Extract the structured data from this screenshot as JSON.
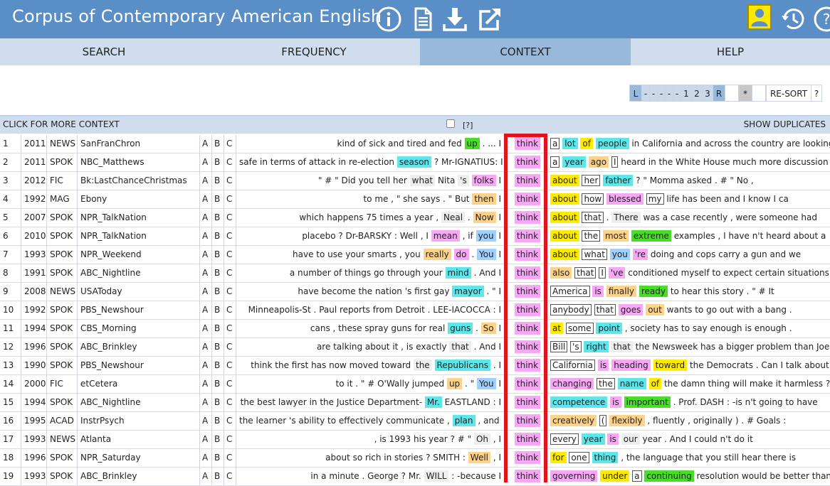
{
  "app": {
    "title": "Corpus of Contemporary American English",
    "icons": [
      "info-icon",
      "document-icon",
      "download-icon",
      "external-link-icon",
      "user-icon",
      "history-icon",
      "help-icon"
    ],
    "header_color": "#5a8ec6"
  },
  "tabs": [
    {
      "label": "SEARCH",
      "active": false
    },
    {
      "label": "FREQUENCY",
      "active": false
    },
    {
      "label": "CONTEXT",
      "active": true
    },
    {
      "label": "HELP",
      "active": false
    }
  ],
  "pager": {
    "items": [
      "L",
      "-",
      "-",
      "-",
      "-",
      "-",
      "1",
      "2",
      "3",
      "R",
      "",
      "*",
      "",
      "RE-SORT",
      "?"
    ]
  },
  "controls": {
    "more_context": "CLICK FOR MORE CONTEXT",
    "help_link": "[?]",
    "show_duplicates": "SHOW DUPLICATES"
  },
  "keyword": "think",
  "rows": [
    {
      "n": "1",
      "year": "2011",
      "genre": "NEWS",
      "source": "SanFranChron",
      "left": [
        [
          "kind of sick and tired and fed ",
          ""
        ],
        [
          "up",
          "green"
        ],
        [
          " . ... I",
          ""
        ]
      ],
      "right": [
        [
          "a",
          "bx"
        ],
        [
          " ",
          ""
        ],
        [
          "lot",
          "cyan"
        ],
        [
          " ",
          ""
        ],
        [
          "of",
          "yellow"
        ],
        [
          " ",
          ""
        ],
        [
          "people",
          "cyan"
        ],
        [
          " in California and across the country are looking",
          ""
        ]
      ]
    },
    {
      "n": "2",
      "year": "2011",
      "genre": "SPOK",
      "source": "NBC_Matthews",
      "left": [
        [
          "safe in terms of attack in re-election ",
          ""
        ],
        [
          "season",
          "cyan"
        ],
        [
          " ? Mr-IGNATIUS: I",
          ""
        ]
      ],
      "right": [
        [
          "a",
          "bx"
        ],
        [
          " ",
          ""
        ],
        [
          "year",
          "cyan"
        ],
        [
          " ",
          ""
        ],
        [
          "ago",
          "orange"
        ],
        [
          " ",
          ""
        ],
        [
          "I",
          "bx"
        ],
        [
          " heard in the White House much more discussion",
          ""
        ]
      ]
    },
    {
      "n": "3",
      "year": "2012",
      "genre": "FIC",
      "source": "Bk:LastChanceChristmas",
      "left": [
        [
          "\" # \" Did you tell her ",
          ""
        ],
        [
          "what",
          "grey"
        ],
        [
          " Nita ",
          ""
        ],
        [
          "'s",
          "grey"
        ],
        [
          " ",
          ""
        ],
        [
          "folks",
          "pink"
        ],
        [
          " I",
          ""
        ]
      ],
      "right": [
        [
          "about",
          "yellow"
        ],
        [
          " ",
          ""
        ],
        [
          "her",
          "bx"
        ],
        [
          " ",
          ""
        ],
        [
          "father",
          "cyan"
        ],
        [
          " ? \" Momma asked . # \" No ,",
          ""
        ]
      ]
    },
    {
      "n": "4",
      "year": "1992",
      "genre": "MAG",
      "source": "Ebony",
      "left": [
        [
          "to me , \" she says . \" But ",
          ""
        ],
        [
          "then",
          "orange"
        ],
        [
          " I",
          ""
        ]
      ],
      "right": [
        [
          "about",
          "yellow"
        ],
        [
          " ",
          ""
        ],
        [
          "how",
          "bx"
        ],
        [
          " ",
          ""
        ],
        [
          "blessed",
          "pink"
        ],
        [
          " ",
          ""
        ],
        [
          "my",
          "bx"
        ],
        [
          " life has been and I know I ca",
          ""
        ]
      ]
    },
    {
      "n": "5",
      "year": "2007",
      "genre": "SPOK",
      "source": "NPR_TalkNation",
      "left": [
        [
          "which happens 75 times a year , ",
          ""
        ],
        [
          "Neal",
          "grey"
        ],
        [
          " . ",
          ""
        ],
        [
          "Now",
          "orange"
        ],
        [
          " I",
          ""
        ]
      ],
      "right": [
        [
          "about",
          "yellow"
        ],
        [
          " ",
          ""
        ],
        [
          "that",
          "bx"
        ],
        [
          " . ",
          ""
        ],
        [
          "There",
          "grey"
        ],
        [
          " was a case recently , were someone had",
          ""
        ]
      ]
    },
    {
      "n": "6",
      "year": "2010",
      "genre": "SPOK",
      "source": "NPR_TalkNation",
      "left": [
        [
          "placebo ? Dr-BARSKY : Well , I ",
          ""
        ],
        [
          "mean",
          "pink"
        ],
        [
          " , if ",
          ""
        ],
        [
          "you",
          "blue"
        ],
        [
          " I",
          ""
        ]
      ],
      "right": [
        [
          "about",
          "yellow"
        ],
        [
          " ",
          ""
        ],
        [
          "the",
          "bx"
        ],
        [
          " ",
          ""
        ],
        [
          "most",
          "orange"
        ],
        [
          " ",
          ""
        ],
        [
          "extreme",
          "green"
        ],
        [
          " examples , I have n't heard about a",
          ""
        ]
      ]
    },
    {
      "n": "7",
      "year": "1993",
      "genre": "SPOK",
      "source": "NPR_Weekend",
      "left": [
        [
          "have to use your smarts , you ",
          ""
        ],
        [
          "really",
          "orange"
        ],
        [
          " ",
          ""
        ],
        [
          "do",
          "pink"
        ],
        [
          " . ",
          ""
        ],
        [
          "You",
          "blue"
        ],
        [
          " I",
          ""
        ]
      ],
      "right": [
        [
          "about",
          "yellow"
        ],
        [
          " ",
          ""
        ],
        [
          "what",
          "bx"
        ],
        [
          " ",
          ""
        ],
        [
          "you",
          "blue"
        ],
        [
          " ",
          ""
        ],
        [
          "'re",
          "pink"
        ],
        [
          " doing and cops carry a gun and we",
          ""
        ]
      ]
    },
    {
      "n": "8",
      "year": "1991",
      "genre": "SPOK",
      "source": "ABC_Nightline",
      "left": [
        [
          "a number of things go through your ",
          ""
        ],
        [
          "mind",
          "cyan"
        ],
        [
          " . And I",
          ""
        ]
      ],
      "right": [
        [
          "also",
          "orange"
        ],
        [
          " ",
          ""
        ],
        [
          "that",
          "bx"
        ],
        [
          " ",
          ""
        ],
        [
          "I",
          "bx"
        ],
        [
          " ",
          ""
        ],
        [
          "'ve",
          "pink"
        ],
        [
          " conditioned myself to expect certain situations",
          ""
        ]
      ]
    },
    {
      "n": "9",
      "year": "2008",
      "genre": "NEWS",
      "source": "USAToday",
      "left": [
        [
          "have become the nation 's first gay ",
          ""
        ],
        [
          "mayor",
          "cyan"
        ],
        [
          " . \" I",
          ""
        ]
      ],
      "right": [
        [
          "America",
          "bx"
        ],
        [
          " ",
          ""
        ],
        [
          "is",
          "pink"
        ],
        [
          " ",
          ""
        ],
        [
          "finally",
          "orange"
        ],
        [
          " ",
          ""
        ],
        [
          "ready",
          "green"
        ],
        [
          " to hear this story . \" # It",
          ""
        ]
      ]
    },
    {
      "n": "10",
      "year": "1992",
      "genre": "SPOK",
      "source": "PBS_Newshour",
      "left": [
        [
          "Minneapolis-St . Paul reports from Detroit . LEE-IACOCCA : I",
          ""
        ]
      ],
      "right": [
        [
          "anybody",
          "bx"
        ],
        [
          " ",
          ""
        ],
        [
          "that",
          "bx"
        ],
        [
          " ",
          ""
        ],
        [
          "goes",
          "pink"
        ],
        [
          " ",
          ""
        ],
        [
          "out",
          "orange"
        ],
        [
          " wants to go out with a bang .",
          ""
        ]
      ]
    },
    {
      "n": "11",
      "year": "1994",
      "genre": "SPOK",
      "source": "CBS_Morning",
      "left": [
        [
          "cans , these spray guns for real ",
          ""
        ],
        [
          "guns",
          "cyan"
        ],
        [
          " . ",
          ""
        ],
        [
          "So",
          "orange"
        ],
        [
          " I",
          ""
        ]
      ],
      "right": [
        [
          "at",
          "yellow"
        ],
        [
          " ",
          ""
        ],
        [
          "some",
          "bx"
        ],
        [
          " ",
          ""
        ],
        [
          "point",
          "cyan"
        ],
        [
          " , society has to say enough is enough .",
          ""
        ]
      ]
    },
    {
      "n": "12",
      "year": "1996",
      "genre": "SPOK",
      "source": "ABC_Brinkley",
      "left": [
        [
          "are talking about it , is exactly ",
          ""
        ],
        [
          "that",
          "grey"
        ],
        [
          " . And I",
          ""
        ]
      ],
      "right": [
        [
          "Bill",
          "bx"
        ],
        [
          " ",
          ""
        ],
        [
          "'s",
          "bx"
        ],
        [
          " ",
          ""
        ],
        [
          "right",
          "cyan"
        ],
        [
          " ",
          ""
        ],
        [
          "that",
          "grey"
        ],
        [
          " the Newsweek has a bigger problem than Joe",
          ""
        ]
      ]
    },
    {
      "n": "13",
      "year": "1990",
      "genre": "SPOK",
      "source": "PBS_Newshour",
      "left": [
        [
          "think the first has now moved toward ",
          ""
        ],
        [
          "the",
          "grey"
        ],
        [
          " ",
          ""
        ],
        [
          "Republicans",
          "cyan"
        ],
        [
          " . I",
          ""
        ]
      ],
      "right": [
        [
          "California",
          "bx"
        ],
        [
          " ",
          ""
        ],
        [
          "is",
          "pink"
        ],
        [
          " ",
          ""
        ],
        [
          "heading",
          "pink"
        ],
        [
          " ",
          ""
        ],
        [
          "toward",
          "yellow"
        ],
        [
          " the Democrats . Can I talk about the",
          ""
        ]
      ]
    },
    {
      "n": "14",
      "year": "2000",
      "genre": "FIC",
      "source": "etCetera",
      "left": [
        [
          "to it . \" # O'Wally jumped ",
          ""
        ],
        [
          "up",
          "orange"
        ],
        [
          " . \" ",
          ""
        ],
        [
          "You",
          "blue"
        ],
        [
          " I",
          ""
        ]
      ],
      "right": [
        [
          "changing",
          "pink"
        ],
        [
          " ",
          ""
        ],
        [
          "the",
          "bx"
        ],
        [
          " ",
          ""
        ],
        [
          "name",
          "cyan"
        ],
        [
          " ",
          ""
        ],
        [
          "of",
          "yellow"
        ],
        [
          " the damn thing will make it harmless ?",
          ""
        ]
      ]
    },
    {
      "n": "15",
      "year": "1994",
      "genre": "SPOK",
      "source": "ABC_Nightline",
      "left": [
        [
          "the best lawyer in the Justice Department- ",
          ""
        ],
        [
          "Mr.",
          "cyan"
        ],
        [
          " EASTLAND : I",
          ""
        ]
      ],
      "right": [
        [
          "competence",
          "cyan"
        ],
        [
          " ",
          ""
        ],
        [
          "is",
          "pink"
        ],
        [
          " ",
          ""
        ],
        [
          "important",
          "green"
        ],
        [
          " . Prof. DASH : -is n't going to have",
          ""
        ]
      ]
    },
    {
      "n": "16",
      "year": "1995",
      "genre": "ACAD",
      "source": "InstrPsych",
      "left": [
        [
          "the learner 's ability to effectively communicate , ",
          ""
        ],
        [
          "plan",
          "cyan"
        ],
        [
          " , and I",
          ""
        ]
      ],
      "right": [
        [
          "creatively",
          "orange"
        ],
        [
          " ",
          ""
        ],
        [
          "(",
          "bx"
        ],
        [
          " ",
          ""
        ],
        [
          "flexibly",
          "orange"
        ],
        [
          " , fluently , originally ) . # Goals :",
          ""
        ]
      ]
    },
    {
      "n": "17",
      "year": "1993",
      "genre": "NEWS",
      "source": "Atlanta",
      "left": [
        [
          ", is 1993 his year ? # \" ",
          ""
        ],
        [
          "Oh",
          "grey"
        ],
        [
          " , I",
          ""
        ]
      ],
      "right": [
        [
          "every",
          "bx"
        ],
        [
          " ",
          ""
        ],
        [
          "year",
          "cyan"
        ],
        [
          " ",
          ""
        ],
        [
          "is",
          "pink"
        ],
        [
          " ",
          ""
        ],
        [
          "our",
          "grey"
        ],
        [
          " year . And I could n't do it",
          ""
        ]
      ]
    },
    {
      "n": "18",
      "year": "1996",
      "genre": "SPOK",
      "source": "NPR_Saturday",
      "left": [
        [
          "about so rich in stories ? SMITH : ",
          ""
        ],
        [
          "Well",
          "orange"
        ],
        [
          " , I",
          ""
        ]
      ],
      "right": [
        [
          "for",
          "yellow"
        ],
        [
          " ",
          ""
        ],
        [
          "one",
          "bx"
        ],
        [
          " ",
          ""
        ],
        [
          "thing",
          "cyan"
        ],
        [
          " , the language that you still hear there is",
          ""
        ]
      ]
    },
    {
      "n": "19",
      "year": "1993",
      "genre": "SPOK",
      "source": "ABC_Brinkley",
      "left": [
        [
          "in a minute . George ? Mr. ",
          ""
        ],
        [
          "WILL",
          "grey"
        ],
        [
          " : -because I",
          ""
        ]
      ],
      "right": [
        [
          "governing",
          "pink"
        ],
        [
          " ",
          ""
        ],
        [
          "under",
          "yellow"
        ],
        [
          " ",
          ""
        ],
        [
          "a",
          "bx"
        ],
        [
          " ",
          ""
        ],
        [
          "continuing",
          "green"
        ],
        [
          " resolution would be better than",
          ""
        ]
      ]
    }
  ],
  "colors": {
    "header": "#5a8ec6",
    "tab_bar": "#cfddee",
    "tab_active": "#98b9da",
    "keyword_highlight": "#f7a8f5",
    "keyword_box": "#e3131b",
    "user_icon_bg": "#ffe800"
  }
}
